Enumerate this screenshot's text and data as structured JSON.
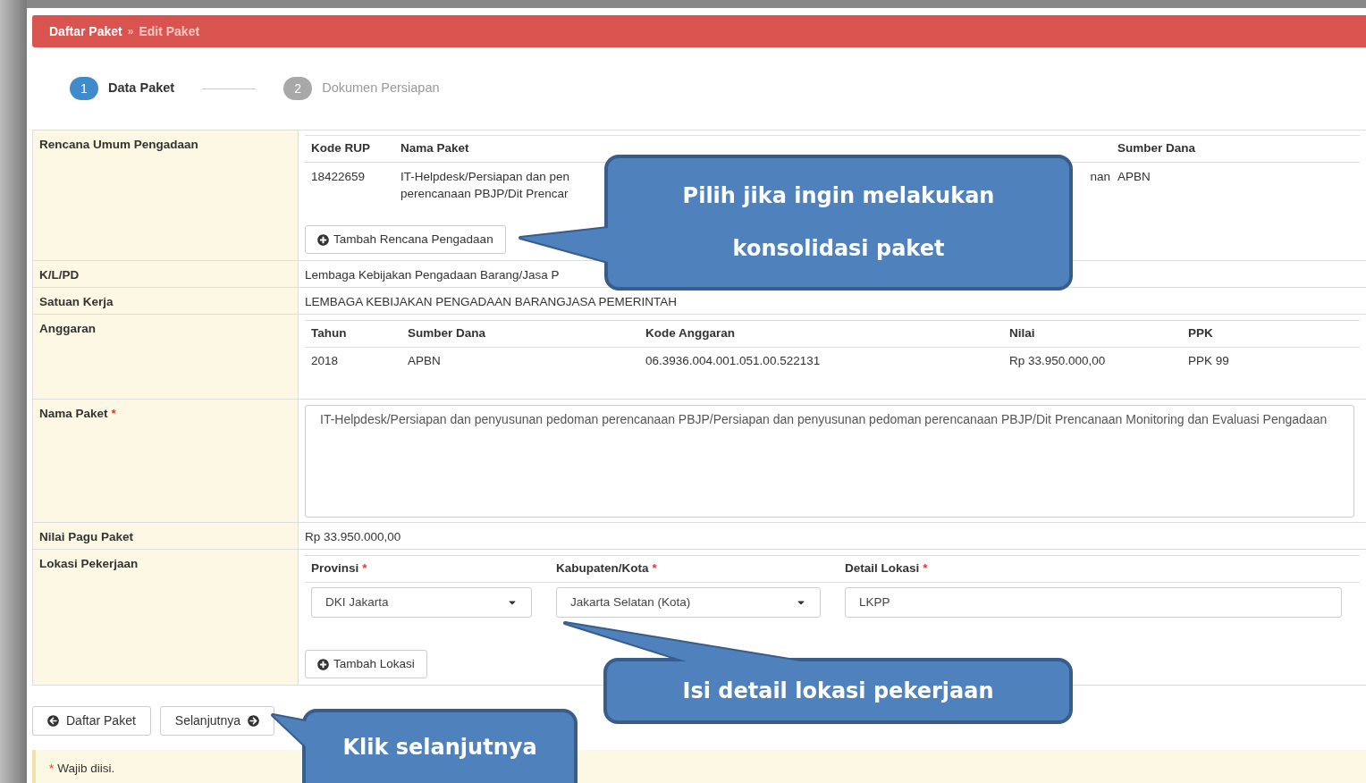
{
  "breadcrumb": {
    "items": [
      {
        "label": "Daftar Paket",
        "selected": false
      },
      {
        "label": "Edit Paket",
        "selected": true
      }
    ],
    "separator": "»"
  },
  "steps": [
    {
      "number": "1",
      "label": "Data Paket",
      "selected": true
    },
    {
      "number": "2",
      "label": "Dokumen Persiapan",
      "selected": false
    }
  ],
  "rencana_umum": {
    "label": "Rencana Umum Pengadaan",
    "columns": [
      "Kode RUP",
      "Nama Paket",
      "Sumber Dana"
    ],
    "rows": [
      {
        "kode_rup": "18422659",
        "nama_paket": [
          "IT-Helpdesk/Persiapan dan pen",
          "perencanaan PBJP/Dit Prencar"
        ],
        "column_3": "nan",
        "sumber_dana": "APBN"
      }
    ],
    "add_button": "Tambah Rencana Pengadaan"
  },
  "kl_pd": {
    "label": "K/L/PD",
    "value": "Lembaga Kebijakan Pengadaan Barang/Jasa P"
  },
  "satuan_kerja": {
    "label": "Satuan Kerja",
    "value": "LEMBAGA KEBIJAKAN PENGADAAN BARANGJASA PEMERINTAH"
  },
  "anggaran": {
    "label": "Anggaran",
    "columns": [
      "Tahun",
      "Sumber Dana",
      "Kode Anggaran",
      "Nilai",
      "PPK"
    ],
    "rows": [
      [
        "2018",
        "APBN",
        "06.3936.004.001.051.00.522131",
        "Rp 33.950.000,00",
        "PPK 99"
      ]
    ]
  },
  "nama_paket": {
    "label": "Nama Paket",
    "required_mark": "*",
    "value": "IT-Helpdesk/Persiapan dan penyusunan pedoman perencanaan PBJP/Persiapan dan penyusunan pedoman perencanaan PBJP/Dit Prencanaan Monitoring dan Evaluasi Pengadaan"
  },
  "nilai_pagu": {
    "label": "Nilai Pagu Paket",
    "value": "Rp 33.950.000,00"
  },
  "lokasi": {
    "label": "Lokasi Pekerjaan",
    "fields": [
      {
        "label": "Provinsi",
        "required_mark": "*",
        "kind": "select",
        "value": "DKI Jakarta"
      },
      {
        "label": "Kabupaten/Kota",
        "required_mark": "*",
        "kind": "select",
        "value": "Jakarta Selatan (Kota)"
      },
      {
        "label": "Detail Lokasi",
        "required_mark": "*",
        "kind": "text",
        "value": "LKPP"
      }
    ],
    "add_button": "Tambah Lokasi"
  },
  "buttons": {
    "back": "Daftar Paket",
    "next": "Selanjutnya"
  },
  "note": {
    "mark": "*",
    "text": "Wajib diisi."
  },
  "callouts": [
    {
      "lines": [
        "Pilih jika ingin melakukan",
        "konsolidasi paket"
      ]
    },
    {
      "lines": [
        "Isi detail lokasi pekerjaan"
      ]
    },
    {
      "lines": [
        "Klik selanjutnya"
      ]
    }
  ]
}
